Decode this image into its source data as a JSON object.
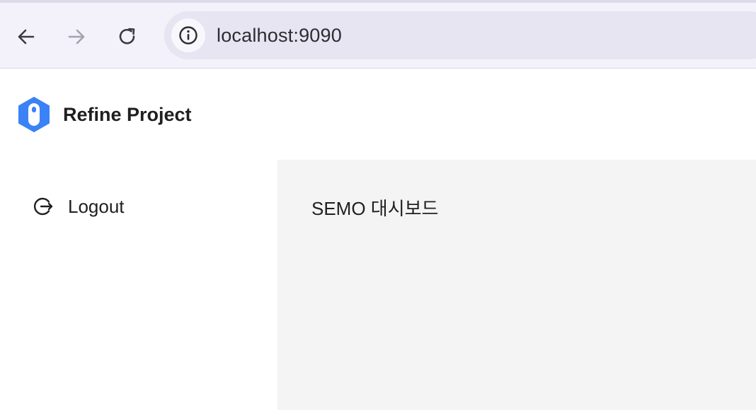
{
  "browser": {
    "url": "localhost:9090",
    "icons": {
      "back": "arrow-left-icon",
      "forward": "arrow-right-icon",
      "reload": "reload-icon",
      "site_info": "info-icon"
    }
  },
  "header": {
    "project_name": "Refine Project",
    "logo_icon": "refine-logo-icon",
    "brand_color": "#3b82f6"
  },
  "sidebar": {
    "items": [
      {
        "label": "Logout",
        "icon": "logout-icon"
      }
    ]
  },
  "main": {
    "title": "SEMO 대시보드",
    "background": "#f4f4f4"
  }
}
